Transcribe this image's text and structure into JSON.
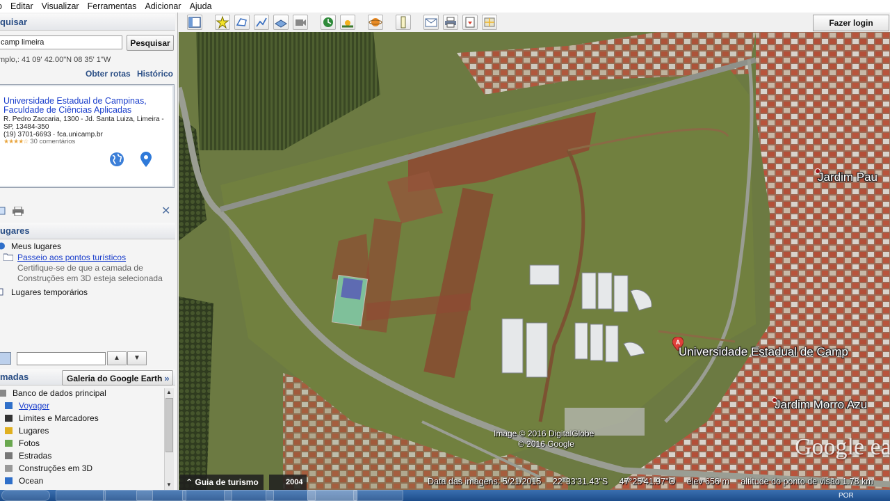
{
  "menu": [
    "o",
    "Editar",
    "Visualizar",
    "Ferramentas",
    "Adicionar",
    "Ajuda"
  ],
  "search": {
    "header": "quisar",
    "query": "camp limeira",
    "button": "Pesquisar",
    "example": "mplo,: 41 09' 42.00\"N 08 35' 1\"W",
    "directions": "Obter rotas",
    "history": "Histórico"
  },
  "result": {
    "title": "Universidade Estadual de Campinas, Faculdade de Ciências Aplicadas",
    "address": "R. Pedro Zaccaria, 1300 - Jd. Santa Luiza, Limeira - SP, 13484-350",
    "phone": "(19) 3701-6693 · fca.unicamp.br",
    "stars": "★★★★☆",
    "reviews": "30 comentários"
  },
  "places": {
    "header": "ugares",
    "my_places": "Meus lugares",
    "tour": "Passeio aos pontos turísticos",
    "tour_note": "Certifique-se de que a camada de Construções em 3D esteja selecionada",
    "temporary": "Lugares temporários"
  },
  "layers": {
    "header": "madas",
    "gallery": "Galeria do Google Earth",
    "items": [
      {
        "label": "Banco de dados principal",
        "icon": "database-icon",
        "link": false
      },
      {
        "label": "Voyager",
        "icon": "voyager-icon",
        "link": true
      },
      {
        "label": "Limites e Marcadores",
        "icon": "borders-icon",
        "link": false
      },
      {
        "label": "Lugares",
        "icon": "places-icon",
        "link": false
      },
      {
        "label": "Fotos",
        "icon": "photos-icon",
        "link": false
      },
      {
        "label": "Estradas",
        "icon": "roads-icon",
        "link": false
      },
      {
        "label": "Construções em 3D",
        "icon": "buildings-3d-icon",
        "link": false
      },
      {
        "label": "Ocean",
        "icon": "ocean-icon",
        "link": false
      }
    ]
  },
  "toolbar": {
    "signin": "Fazer login"
  },
  "map": {
    "label_university": "Universidade Estadual de Camp",
    "label_jardim_paulista": "Jardim Pau",
    "label_morro_azul": "Jardim Morro Azu",
    "copyright_1": "Image © 2016 DigitalGlobe",
    "copyright_2": "© 2016 Google",
    "watermark": "Google ea",
    "marker_letter": "A"
  },
  "status": {
    "tour_guide": "Guia de turismo",
    "year": "2004",
    "image_date": "Data das imagens: 5/21/2015",
    "latitude": "22°33'31.43\"S",
    "longitude": "47°25'41.97\"O",
    "elevation": "elev   656 m",
    "eye_altitude": "altitude do ponto de visão   1.78 km"
  },
  "taskbar": {
    "language": "POR"
  },
  "colors": {
    "link": "#1a3ecc",
    "header_text": "#2b4f86",
    "dirt": "#8e4a33",
    "field": "#6e7a44"
  }
}
